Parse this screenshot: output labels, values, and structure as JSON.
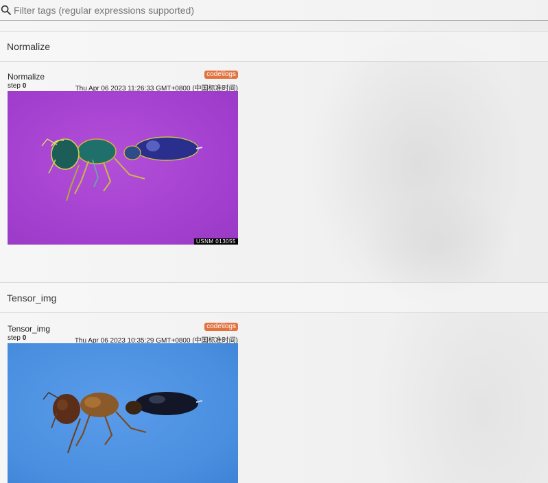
{
  "filter": {
    "placeholder": "Filter tags (regular expressions supported)"
  },
  "sections": [
    {
      "header": "Normalize",
      "card": {
        "title": "Normalize",
        "run": "code\\logs",
        "step_label": "step",
        "step_value": "0",
        "timestamp": "Thu Apr 06 2023 11:26:33 GMT+0800 (中国标准时间)",
        "image_stamp": "USNM 013055",
        "image_desc": "ant-image-normalized"
      }
    },
    {
      "header": "Tensor_img",
      "card": {
        "title": "Tensor_img",
        "run": "code\\logs",
        "step_label": "step",
        "step_value": "0",
        "timestamp": "Thu Apr 06 2023 10:35:29 GMT+0800 (中国标准时间)",
        "image_desc": "ant-image-original"
      }
    }
  ],
  "colors": {
    "run_badge": "#e2733f",
    "normalized_bg": "#a33fcf",
    "original_bg": "#4a8fe0"
  }
}
